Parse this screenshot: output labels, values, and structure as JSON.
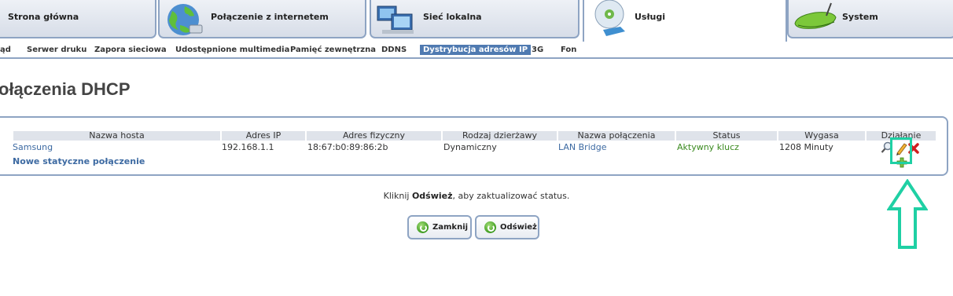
{
  "tabs": [
    {
      "label": "Strona główna",
      "icon": "home-icon"
    },
    {
      "label": "Połączenie z internetem",
      "icon": "globe-icon"
    },
    {
      "label": "Sieć lokalna",
      "icon": "network-computers-icon"
    },
    {
      "label": "Usługi",
      "icon": "disc-services-icon",
      "active": true
    },
    {
      "label": "System",
      "icon": "router-icon"
    }
  ],
  "subnav": {
    "items": [
      "ąd",
      "Serwer druku",
      "Zapora sieciowa",
      "Udostępnione multimedia",
      "Pamięć zewnętrzna",
      "DDNS",
      "Dystrybucja adresów IP",
      "3G",
      "Fon"
    ],
    "active_index": 6
  },
  "page_title": "ołączenia DHCP",
  "table": {
    "headers": [
      "Nazwa hosta",
      "Adres IP",
      "Adres fizyczny",
      "Rodzaj dzierżawy",
      "Nazwa połączenia",
      "Status",
      "Wygasa",
      "Działanie"
    ],
    "rows": [
      {
        "host": "Samsung",
        "ip": "192.168.1.1",
        "mac": "18:67:b0:89:86:2b",
        "lease": "Dynamiczny",
        "connection": "LAN Bridge",
        "status": "Aktywny klucz",
        "expires": "1208 Minuty",
        "actions": [
          "magnifier-icon",
          "pencil-edit-icon",
          "delete-x-icon"
        ]
      }
    ],
    "new_link": "Nowe statyczne połączenie",
    "add_icon": "plus-add-icon"
  },
  "hint": {
    "prefix": "Kliknij ",
    "bold": "Odśwież",
    "suffix": ", aby zaktualizować status."
  },
  "buttons": {
    "close": "Zamknij",
    "refresh": "Odśwież"
  },
  "colors": {
    "accent": "#4f7ab1",
    "border": "#8ea4c3",
    "status_green": "#3b8a1f",
    "annotation": "#1fd0a4"
  }
}
